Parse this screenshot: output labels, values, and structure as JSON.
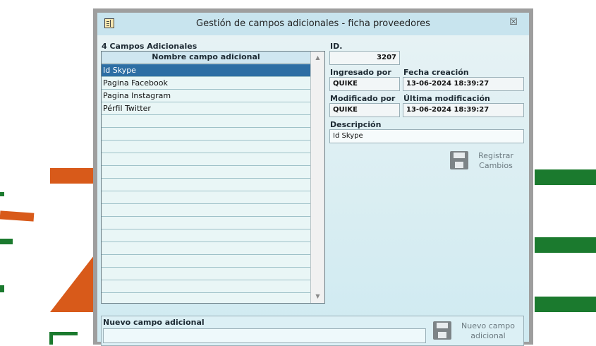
{
  "window": {
    "title": "Gestión de campos adicionales - ficha proveedores",
    "close_glyph": "☒"
  },
  "list": {
    "count_label": "4 Campos Adicionales",
    "column_header": "Nombre campo adicional",
    "items": [
      "Id Skype",
      "Pagina Facebook",
      "Pagina Instagram",
      "Pérfil Twitter"
    ],
    "selected_index": 0,
    "empty_rows": 14
  },
  "detail": {
    "id_label": "ID.",
    "id_value": "3207",
    "ingresado_label": "Ingresado por",
    "ingresado_value": "QUIKE",
    "fecha_creacion_label": "Fecha creación",
    "fecha_creacion_value": "13-06-2024 18:39:27",
    "modificado_label": "Modificado por",
    "modificado_value": "QUIKE",
    "ultima_mod_label": "Última modificación",
    "ultima_mod_value": "13-06-2024 18:39:27",
    "descripcion_label": "Descripción",
    "descripcion_value": "Id Skype",
    "register_line1": "Registrar",
    "register_line2": "Cambios"
  },
  "new_field": {
    "label": "Nuevo campo adicional",
    "value": "",
    "button_line1": "Nuevo campo",
    "button_line2": "adicional"
  },
  "icons": {
    "app": "form-icon",
    "save": "floppy-disk-icon",
    "close": "close-icon"
  }
}
